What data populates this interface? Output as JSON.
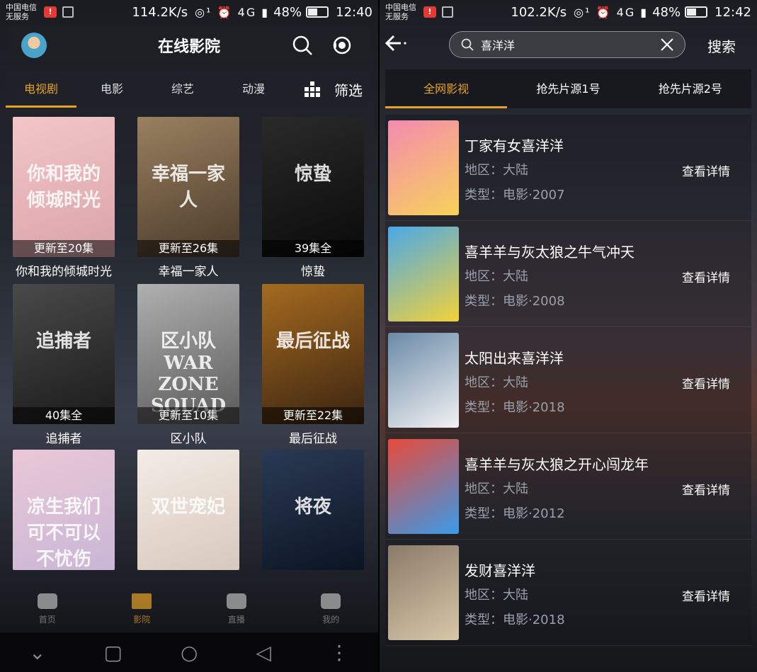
{
  "left": {
    "status": {
      "carrier1": "中国电信",
      "carrier2": "无服务",
      "speed": "114.2K/s",
      "battery": "48%",
      "time": "12:40"
    },
    "header": {
      "title": "在线影院"
    },
    "tabs": [
      "电视剧",
      "电影",
      "综艺",
      "动漫"
    ],
    "filter_label": "筛选",
    "posters": [
      {
        "badge": "更新至20集",
        "title": "你和我的倾城时光",
        "art": "你和我的倾城时光",
        "c1": "#f2c6c8",
        "c2": "#d9a3aa"
      },
      {
        "badge": "更新至26集",
        "title": "幸福一家人",
        "art": "幸福一家人",
        "c1": "#9a8060",
        "c2": "#4a3a2a"
      },
      {
        "badge": "39集全",
        "title": "惊蛰",
        "art": "惊蛰",
        "c1": "#2a2a2a",
        "c2": "#0a0a0a"
      },
      {
        "badge": "40集全",
        "title": "追捕者",
        "art": "追捕者",
        "c1": "#4a4a4a",
        "c2": "#1a1a1a"
      },
      {
        "badge": "更新至10集",
        "title": "区小队",
        "art": "区小队 WAR ZONE SQUAD",
        "c1": "#b0b0b0",
        "c2": "#5a5a5a"
      },
      {
        "badge": "更新至22集",
        "title": "最后征战",
        "art": "最后征战",
        "c1": "#a56a20",
        "c2": "#3a2410"
      },
      {
        "badge": "",
        "title": "",
        "art": "凉生我们可不可以不忧伤",
        "c1": "#eac8d6",
        "c2": "#c9b6d6"
      },
      {
        "badge": "",
        "title": "",
        "art": "双世宠妃",
        "c1": "#f3ece6",
        "c2": "#d8c8bc"
      },
      {
        "badge": "",
        "title": "",
        "art": "将夜",
        "c1": "#2a3a55",
        "c2": "#0c1422"
      }
    ],
    "bottom_nav": [
      "首页",
      "影院",
      "直播",
      "我的"
    ]
  },
  "right": {
    "status": {
      "carrier1": "中国电信",
      "carrier2": "无服务",
      "speed": "102.2K/s",
      "battery": "48%",
      "time": "12:42"
    },
    "search": {
      "value": "喜洋洋",
      "button": "搜索"
    },
    "tabs": [
      "全网影视",
      "抢先片源1号",
      "抢先片源2号"
    ],
    "results": [
      {
        "title": "丁家有女喜洋洋",
        "area": "地区：大陆",
        "type": "类型：电影·2007",
        "detail": "查看详情",
        "c1": "#f48ab0",
        "c2": "#f7d25a"
      },
      {
        "title": "喜羊羊与灰太狼之牛气冲天",
        "area": "地区：大陆",
        "type": "类型：电影·2008",
        "detail": "查看详情",
        "c1": "#4aa8e8",
        "c2": "#f2d23a"
      },
      {
        "title": "太阳出来喜洋洋",
        "area": "地区：大陆",
        "type": "类型：电影·2018",
        "detail": "查看详情",
        "c1": "#6a8aa8",
        "c2": "#f2f2f2"
      },
      {
        "title": "喜羊羊与灰太狼之开心闯龙年",
        "area": "地区：大陆",
        "type": "类型：电影·2012",
        "detail": "查看详情",
        "c1": "#e84a3a",
        "c2": "#3a9ae8"
      },
      {
        "title": "发财喜洋洋",
        "area": "地区：大陆",
        "type": "类型：电影·2018",
        "detail": "查看详情",
        "c1": "#8a7a6a",
        "c2": "#d8c8a8"
      }
    ]
  },
  "accent": "#e6a227"
}
